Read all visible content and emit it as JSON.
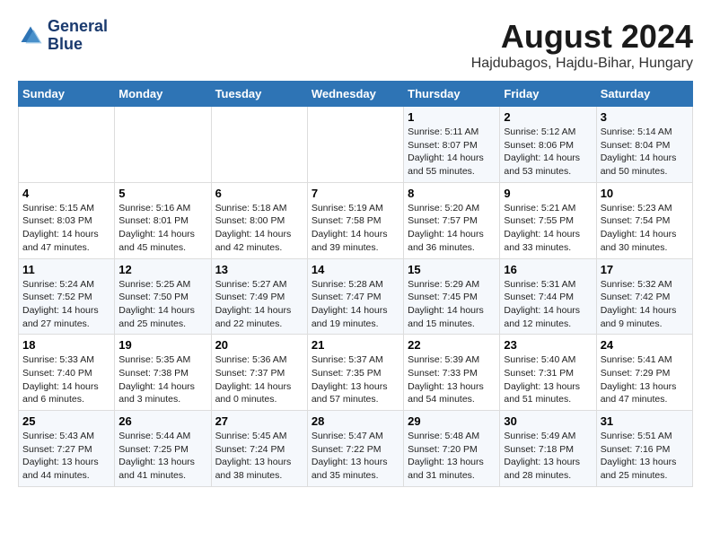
{
  "header": {
    "logo_line1": "General",
    "logo_line2": "Blue",
    "month_year": "August 2024",
    "location": "Hajdubagos, Hajdu-Bihar, Hungary"
  },
  "weekdays": [
    "Sunday",
    "Monday",
    "Tuesday",
    "Wednesday",
    "Thursday",
    "Friday",
    "Saturday"
  ],
  "weeks": [
    [
      {
        "day": "",
        "text": ""
      },
      {
        "day": "",
        "text": ""
      },
      {
        "day": "",
        "text": ""
      },
      {
        "day": "",
        "text": ""
      },
      {
        "day": "1",
        "text": "Sunrise: 5:11 AM\nSunset: 8:07 PM\nDaylight: 14 hours\nand 55 minutes."
      },
      {
        "day": "2",
        "text": "Sunrise: 5:12 AM\nSunset: 8:06 PM\nDaylight: 14 hours\nand 53 minutes."
      },
      {
        "day": "3",
        "text": "Sunrise: 5:14 AM\nSunset: 8:04 PM\nDaylight: 14 hours\nand 50 minutes."
      }
    ],
    [
      {
        "day": "4",
        "text": "Sunrise: 5:15 AM\nSunset: 8:03 PM\nDaylight: 14 hours\nand 47 minutes."
      },
      {
        "day": "5",
        "text": "Sunrise: 5:16 AM\nSunset: 8:01 PM\nDaylight: 14 hours\nand 45 minutes."
      },
      {
        "day": "6",
        "text": "Sunrise: 5:18 AM\nSunset: 8:00 PM\nDaylight: 14 hours\nand 42 minutes."
      },
      {
        "day": "7",
        "text": "Sunrise: 5:19 AM\nSunset: 7:58 PM\nDaylight: 14 hours\nand 39 minutes."
      },
      {
        "day": "8",
        "text": "Sunrise: 5:20 AM\nSunset: 7:57 PM\nDaylight: 14 hours\nand 36 minutes."
      },
      {
        "day": "9",
        "text": "Sunrise: 5:21 AM\nSunset: 7:55 PM\nDaylight: 14 hours\nand 33 minutes."
      },
      {
        "day": "10",
        "text": "Sunrise: 5:23 AM\nSunset: 7:54 PM\nDaylight: 14 hours\nand 30 minutes."
      }
    ],
    [
      {
        "day": "11",
        "text": "Sunrise: 5:24 AM\nSunset: 7:52 PM\nDaylight: 14 hours\nand 27 minutes."
      },
      {
        "day": "12",
        "text": "Sunrise: 5:25 AM\nSunset: 7:50 PM\nDaylight: 14 hours\nand 25 minutes."
      },
      {
        "day": "13",
        "text": "Sunrise: 5:27 AM\nSunset: 7:49 PM\nDaylight: 14 hours\nand 22 minutes."
      },
      {
        "day": "14",
        "text": "Sunrise: 5:28 AM\nSunset: 7:47 PM\nDaylight: 14 hours\nand 19 minutes."
      },
      {
        "day": "15",
        "text": "Sunrise: 5:29 AM\nSunset: 7:45 PM\nDaylight: 14 hours\nand 15 minutes."
      },
      {
        "day": "16",
        "text": "Sunrise: 5:31 AM\nSunset: 7:44 PM\nDaylight: 14 hours\nand 12 minutes."
      },
      {
        "day": "17",
        "text": "Sunrise: 5:32 AM\nSunset: 7:42 PM\nDaylight: 14 hours\nand 9 minutes."
      }
    ],
    [
      {
        "day": "18",
        "text": "Sunrise: 5:33 AM\nSunset: 7:40 PM\nDaylight: 14 hours\nand 6 minutes."
      },
      {
        "day": "19",
        "text": "Sunrise: 5:35 AM\nSunset: 7:38 PM\nDaylight: 14 hours\nand 3 minutes."
      },
      {
        "day": "20",
        "text": "Sunrise: 5:36 AM\nSunset: 7:37 PM\nDaylight: 14 hours\nand 0 minutes."
      },
      {
        "day": "21",
        "text": "Sunrise: 5:37 AM\nSunset: 7:35 PM\nDaylight: 13 hours\nand 57 minutes."
      },
      {
        "day": "22",
        "text": "Sunrise: 5:39 AM\nSunset: 7:33 PM\nDaylight: 13 hours\nand 54 minutes."
      },
      {
        "day": "23",
        "text": "Sunrise: 5:40 AM\nSunset: 7:31 PM\nDaylight: 13 hours\nand 51 minutes."
      },
      {
        "day": "24",
        "text": "Sunrise: 5:41 AM\nSunset: 7:29 PM\nDaylight: 13 hours\nand 47 minutes."
      }
    ],
    [
      {
        "day": "25",
        "text": "Sunrise: 5:43 AM\nSunset: 7:27 PM\nDaylight: 13 hours\nand 44 minutes."
      },
      {
        "day": "26",
        "text": "Sunrise: 5:44 AM\nSunset: 7:25 PM\nDaylight: 13 hours\nand 41 minutes."
      },
      {
        "day": "27",
        "text": "Sunrise: 5:45 AM\nSunset: 7:24 PM\nDaylight: 13 hours\nand 38 minutes."
      },
      {
        "day": "28",
        "text": "Sunrise: 5:47 AM\nSunset: 7:22 PM\nDaylight: 13 hours\nand 35 minutes."
      },
      {
        "day": "29",
        "text": "Sunrise: 5:48 AM\nSunset: 7:20 PM\nDaylight: 13 hours\nand 31 minutes."
      },
      {
        "day": "30",
        "text": "Sunrise: 5:49 AM\nSunset: 7:18 PM\nDaylight: 13 hours\nand 28 minutes."
      },
      {
        "day": "31",
        "text": "Sunrise: 5:51 AM\nSunset: 7:16 PM\nDaylight: 13 hours\nand 25 minutes."
      }
    ]
  ]
}
